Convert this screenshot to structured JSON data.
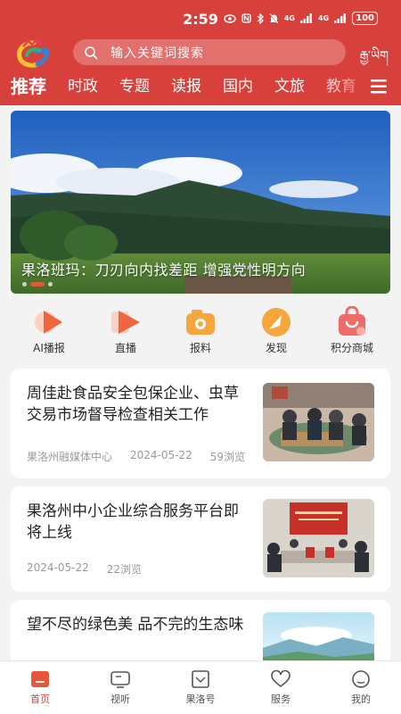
{
  "status_bar": {
    "time": "2:59",
    "network": "4G",
    "battery": "100"
  },
  "header": {
    "search_placeholder": "输入关键词搜索",
    "tibetan_label": "རྒྱ་ཡིག",
    "brand_color": "#d8403c"
  },
  "tabs": [
    {
      "label": "推荐",
      "active": true
    },
    {
      "label": "时政"
    },
    {
      "label": "专题"
    },
    {
      "label": "读报"
    },
    {
      "label": "国内"
    },
    {
      "label": "文旅"
    },
    {
      "label": "教育"
    }
  ],
  "banner": {
    "title": "果洛班玛：刀刃向内找差距 增强党性明方向",
    "slide_count": 3,
    "active_slide": 1
  },
  "shortcuts": [
    {
      "label": "AI播报",
      "icon": "play-icon"
    },
    {
      "label": "直播",
      "icon": "live-icon"
    },
    {
      "label": "报料",
      "icon": "camera-icon"
    },
    {
      "label": "发现",
      "icon": "compass-icon"
    },
    {
      "label": "积分商城",
      "icon": "shopping-bag-icon"
    }
  ],
  "articles": [
    {
      "title": "周佳赴食品安全包保企业、虫草交易市场督导检查相关工作",
      "source": "果洛州融媒体中心",
      "date": "2024-05-22",
      "views": "59浏览"
    },
    {
      "title": "果洛州中小企业综合服务平台即将上线",
      "date": "2024-05-22",
      "views": "22浏览"
    },
    {
      "title": "望不尽的绿色美 品不完的生态味"
    }
  ],
  "bottom_nav": [
    {
      "label": "首页",
      "icon": "home-icon",
      "active": true
    },
    {
      "label": "视听",
      "icon": "tv-icon"
    },
    {
      "label": "果洛号",
      "icon": "account-icon"
    },
    {
      "label": "服务",
      "icon": "heart-icon"
    },
    {
      "label": "我的",
      "icon": "profile-icon"
    }
  ]
}
